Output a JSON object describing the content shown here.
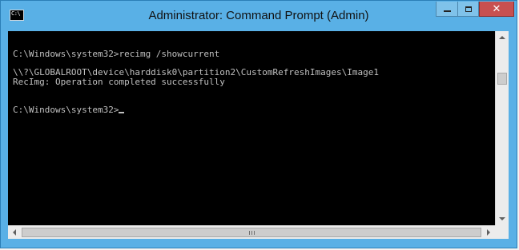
{
  "window": {
    "title": "Administrator: Command Prompt (Admin)",
    "app_icon": "console-icon",
    "app_icon_glyph": "C:\\",
    "colors": {
      "frame": "#59b0e6",
      "console_bg": "#000000",
      "console_text": "#c0c0c0",
      "close_button": "#c75050"
    }
  },
  "controls": {
    "minimize_icon": "minimize-icon",
    "maximize_icon": "maximize-icon",
    "close_icon": "close-icon",
    "close_glyph": "✕"
  },
  "console": {
    "lines": [
      "C:\\Windows\\system32>recimg /showcurrent",
      "\\\\?\\GLOBALROOT\\device\\harddisk0\\partition2\\CustomRefreshImages\\Image1",
      "RecImg: Operation completed successfully",
      "C:\\Windows\\system32>"
    ]
  },
  "scrollbars": {
    "vertical_icons": [
      "scroll-up-arrow-icon",
      "scroll-down-arrow-icon"
    ],
    "horizontal_icons": [
      "scroll-left-arrow-icon",
      "scroll-right-arrow-icon"
    ]
  }
}
